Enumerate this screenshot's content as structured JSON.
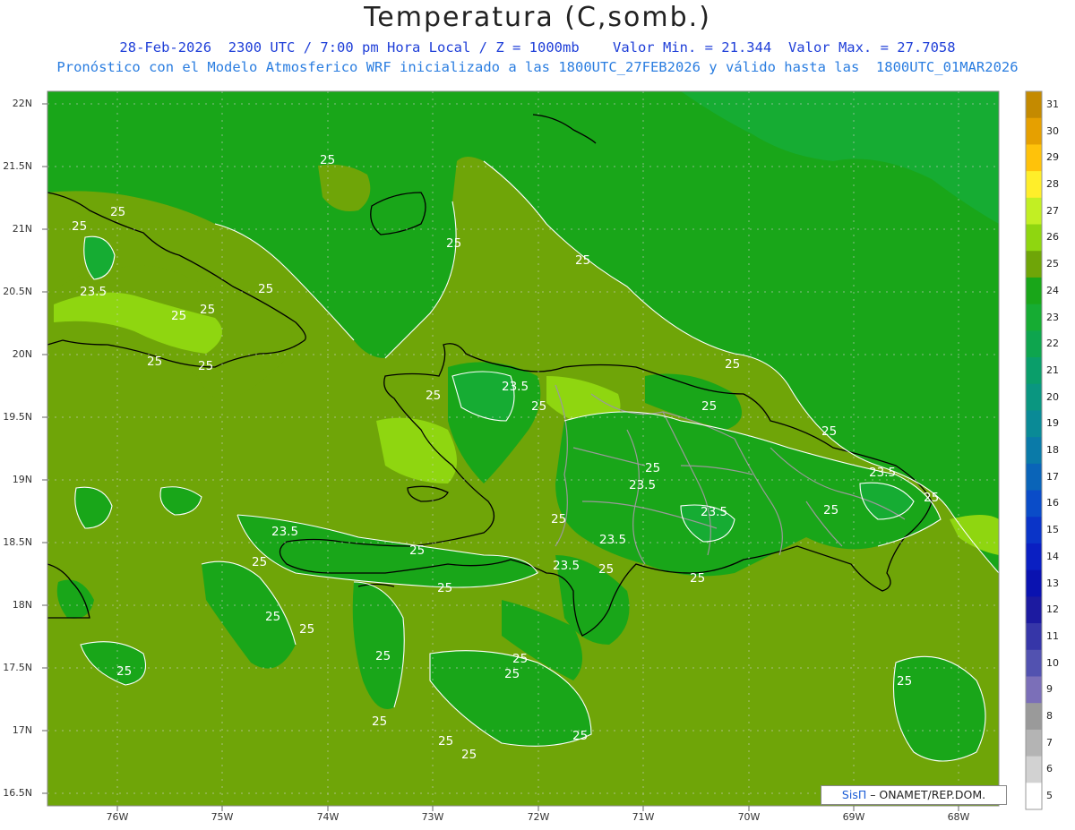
{
  "header": {
    "title": "Temperatura (C,somb.)",
    "line1": "28-Feb-2026  2300 UTC / 7:00 pm Hora Local / Z = 1000mb    Valor Min. = 21.344  Valor Max. = 27.7058",
    "line2": "Pronóstico con el Modelo Atmosferico WRF inicializado a las 1800UTC_27FEB2026 y válido hasta las  1800UTC_01MAR2026"
  },
  "axes": {
    "lat_labels": [
      "22N",
      "21.5N",
      "21N",
      "20.5N",
      "20N",
      "19.5N",
      "19N",
      "18.5N",
      "18N",
      "17.5N",
      "17N",
      "16.5N"
    ],
    "lon_labels": [
      "76W",
      "75W",
      "74W",
      "73W",
      "72W",
      "71W",
      "70W",
      "69W",
      "68W"
    ]
  },
  "colorbar": {
    "labels": [
      "31",
      "30",
      "29",
      "28",
      "27",
      "26",
      "25",
      "24",
      "23",
      "22",
      "21",
      "20",
      "19",
      "18",
      "17",
      "16",
      "15",
      "14",
      "13",
      "12",
      "11",
      "10",
      "9",
      "8",
      "7",
      "6",
      "5"
    ],
    "colors": [
      "#c48a00",
      "#e6a000",
      "#ffc20a",
      "#ffee2a",
      "#c2ef23",
      "#8fd610",
      "#6fa508",
      "#19a619",
      "#16ac33",
      "#0ea54e",
      "#0a9e6a",
      "#0a9680",
      "#0a8a96",
      "#0a7aa8",
      "#0a64b8",
      "#0a4cc8",
      "#0a34c8",
      "#0a1fc2",
      "#0a12b0",
      "#1c1aa0",
      "#3636a8",
      "#5252b0",
      "#7b6fb8",
      "#9a9a9a",
      "#b4b4b4",
      "#d2d2d2",
      "#ffffff"
    ]
  },
  "contour_labels": [
    "25",
    "23.5"
  ],
  "colors": {
    "base_25": "#6fa508",
    "range_24": "#19a619",
    "range_23": "#16ac33",
    "range_26": "#8fd610",
    "coast": "#000000",
    "borders": "#9a9a9a",
    "contour": "#ffffff"
  },
  "credit": {
    "brand": "SisΠ",
    "text": " – ONAMET/REP.DOM."
  }
}
